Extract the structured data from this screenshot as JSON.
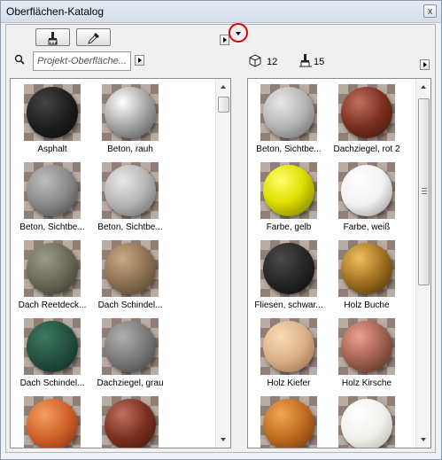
{
  "window": {
    "title": "Oberflächen-Katalog",
    "close_label": "x"
  },
  "toolbar": {
    "brush_icon": "paint-brush-icon",
    "picker_icon": "eyedropper-icon"
  },
  "search": {
    "placeholder": "Projekt-Oberfläche..."
  },
  "right_header": {
    "cube_count": "12",
    "brush_count": "15"
  },
  "left_panel": {
    "items": [
      {
        "label": "Asphalt",
        "sphere": "radial-gradient(circle at 35% 30%, #444 0%, #1c1c1c 55%, #080808 100%)"
      },
      {
        "label": "Beton, rauh",
        "sphere": "radial-gradient(circle at 35% 30%, #ffffff 0%, #b7b7b7 40%, #4a4a4a 100%)"
      },
      {
        "label": "Beton, Sichtbe...",
        "sphere": "radial-gradient(circle at 35% 30%, #bdbdbd 0%, #8a8a8a 50%, #3e3e3e 100%)"
      },
      {
        "label": "Beton, Sichtbe...",
        "sphere": "radial-gradient(circle at 35% 30%, #e8e8e8 0%, #b5b5b5 50%, #5f5f5f 100%)"
      },
      {
        "label": "Dach Reetdeck...",
        "sphere": "radial-gradient(circle at 35% 30%, #9c9a87 0%, #6b6a5a 50%, #33322a 100%)"
      },
      {
        "label": "Dach Schindel...",
        "sphere": "radial-gradient(circle at 35% 30%, #c8ab84 0%, #8e7253 50%, #4b3a28 100%)"
      },
      {
        "label": "Dach Schindel...",
        "sphere": "radial-gradient(circle at 35% 30%, #3d7a5f 0%, #245040 50%, #0f2a20 100%)"
      },
      {
        "label": "Dachziegel, grau",
        "sphere": "radial-gradient(circle at 35% 30%, #b0b0b0 0%, #7a7a7a 50%, #3c3c3c 100%)"
      },
      {
        "label": "",
        "sphere": "radial-gradient(circle at 35% 30%, #f2a060 0%, #d0602a 50%, #7a2c10 100%)"
      },
      {
        "label": "",
        "sphere": "radial-gradient(circle at 35% 30%, #c07060 0%, #7a3020 50%, #3a140c 100%)"
      }
    ]
  },
  "right_panel": {
    "items": [
      {
        "label": "Beton, Sichtbe...",
        "sphere": "radial-gradient(circle at 35% 30%, #e8e8e8 0%, #b5b5b5 50%, #5f5f5f 100%)"
      },
      {
        "label": "Dachziegel, rot 2",
        "sphere": "radial-gradient(circle at 35% 30%, #c07060 0%, #7a3020 50%, #3a140c 100%)"
      },
      {
        "label": "Farbe, gelb",
        "sphere": "radial-gradient(circle at 35% 30%, #ffff70 0%, #e0e000 45%, #6a6a00 100%)"
      },
      {
        "label": "Farbe, weiß",
        "sphere": "radial-gradient(circle at 35% 30%, #ffffff 0%, #f2f2f2 50%, #8c8c8c 100%)"
      },
      {
        "label": "Fliesen, schwar...",
        "sphere": "radial-gradient(circle at 35% 30%, #4a4a4a 0%, #262626 50%, #0a0a0a 100%)"
      },
      {
        "label": "Holz Buche",
        "sphere": "radial-gradient(circle at 35% 30%, #f0c060 0%, #a07020 50%, #402a06 100%)"
      },
      {
        "label": "Holz Kiefer",
        "sphere": "radial-gradient(circle at 35% 30%, #f8dcb8 0%, #dcb088 50%, #8a6440 100%)"
      },
      {
        "label": "Holz Kirsche",
        "sphere": "radial-gradient(circle at 35% 30%, #f0a090 0%, #a06050 50%, #4a2820 100%)"
      },
      {
        "label": "",
        "sphere": "radial-gradient(circle at 35% 30%, #f0a850 0%, #c06a20 50%, #6a3008 100%)"
      },
      {
        "label": "",
        "sphere": "radial-gradient(circle at 35% 30%, #ffffff 0%, #f0f0ec 50%, #b0b0a8 100%)"
      }
    ]
  }
}
